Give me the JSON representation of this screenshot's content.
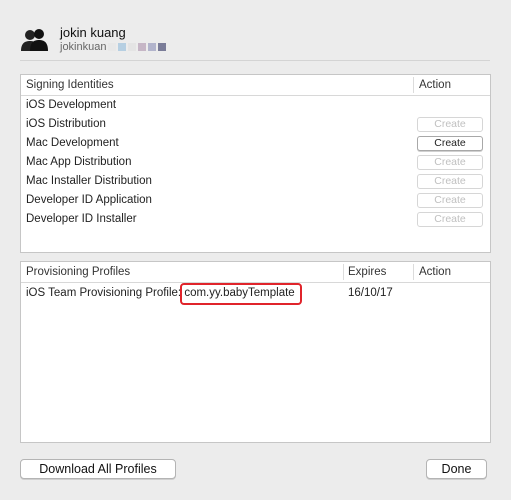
{
  "account": {
    "name": "jokin kuang",
    "id_prefix": "jokinkuan",
    "icon": "people-icon"
  },
  "signing": {
    "header": {
      "title": "Signing Identities",
      "action": "Action"
    },
    "rows": [
      {
        "label": "iOS Development",
        "button": ""
      },
      {
        "label": "iOS Distribution",
        "button": "Create"
      },
      {
        "label": "Mac Development",
        "button": "Create"
      },
      {
        "label": "Mac App Distribution",
        "button": "Create"
      },
      {
        "label": "Mac Installer Distribution",
        "button": "Create"
      },
      {
        "label": "Developer ID Application",
        "button": "Create"
      },
      {
        "label": "Developer ID Installer",
        "button": "Create"
      }
    ]
  },
  "profiles": {
    "header": {
      "title": "Provisioning Profiles",
      "expires": "Expires",
      "action": "Action"
    },
    "rows": [
      {
        "label": "iOS Team Provisioning Profile:",
        "bundle": "com.yy.babyTemplate",
        "expires": "16/10/17"
      }
    ]
  },
  "footer": {
    "download_label": "Download All Profiles",
    "done_label": "Done"
  },
  "colors": {
    "highlight": "#e0242b"
  }
}
